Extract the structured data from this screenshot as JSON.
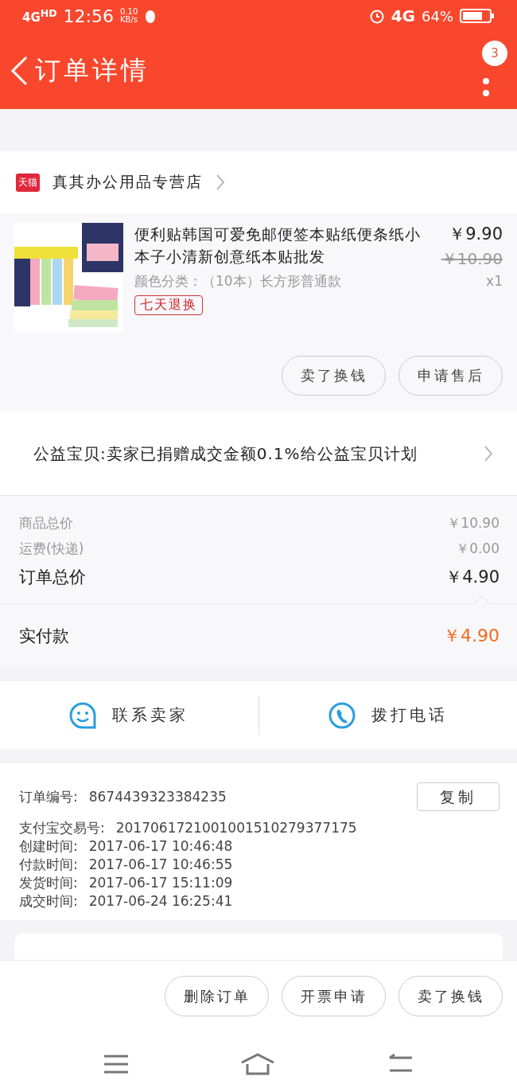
{
  "status_bar": {
    "network": "4G$^{HD}$",
    "time": "12:56",
    "speed": "0.10",
    "speed_unit": "KB/s",
    "mobile": "4G",
    "battery": "64%"
  },
  "header": {
    "title": "订单详情",
    "badge": "3"
  },
  "shop": {
    "badge": "天猫",
    "name": "真其办公用品专营店"
  },
  "item": {
    "title": "便利贴韩国可爱免邮便签本贴纸便条纸小本子小清新创意纸本贴批发",
    "sku": "颜色分类：（10本）长方形普通款",
    "tag": "七天退换",
    "price": "￥9.90",
    "original_price": "￥10.90",
    "quantity": "x1",
    "buttons": [
      "卖了换钱",
      "申请售后"
    ]
  },
  "charity": {
    "text": "公益宝贝:卖家已捐赠成交金额0.1%给公益宝贝计划"
  },
  "prices": [
    {
      "label": "商品总价",
      "value": "￥10.90",
      "kind": "minor"
    },
    {
      "label": "运费(快递)",
      "value": "￥0.00",
      "kind": "minor"
    },
    {
      "label": "订单总价",
      "value": "￥4.90",
      "kind": "major"
    }
  ],
  "paid": {
    "label": "实付款",
    "value": "￥4.90"
  },
  "contact": [
    {
      "label": "联系卖家",
      "kind": "chat"
    },
    {
      "label": "拨打电话",
      "kind": "phone"
    }
  ],
  "order_info": {
    "rows": [
      {
        "label": "订单编号:",
        "value": "8674439323384235"
      },
      {
        "label": "支付宝交易号:",
        "value": "2017061721001001510279377175"
      },
      {
        "label": "创建时间:",
        "value": "2017-06-17 10:46:48"
      },
      {
        "label": "付款时间:",
        "value": "2017-06-17 10:46:55"
      },
      {
        "label": "发货时间:",
        "value": "2017-06-17 15:11:09"
      },
      {
        "label": "成交时间:",
        "value": "2017-06-24 16:25:41"
      }
    ],
    "copy_button": "复制"
  },
  "actions": [
    "删除订单",
    "开票申请",
    "卖了换钱"
  ]
}
